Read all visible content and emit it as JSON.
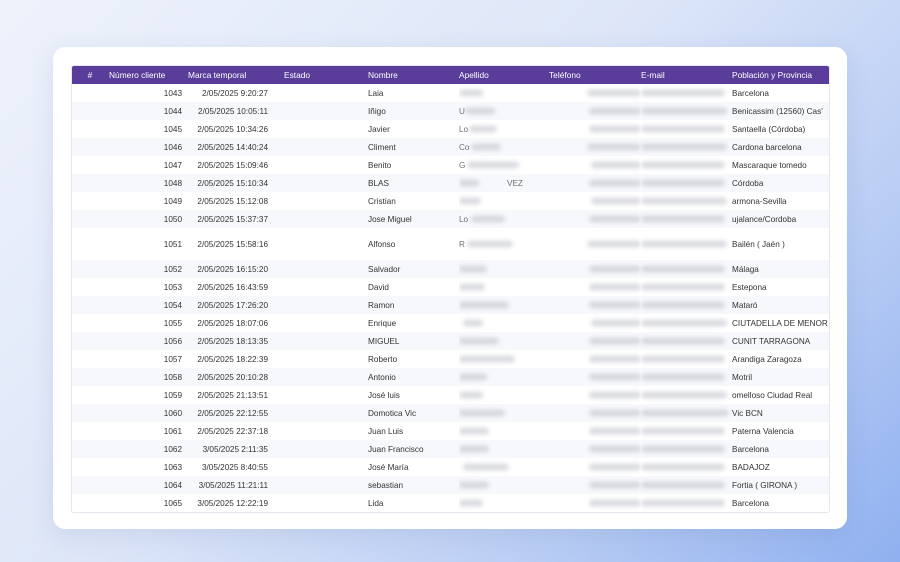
{
  "table": {
    "headers": {
      "num": "#",
      "cliente": "Número cliente",
      "marca": "Marca temporal",
      "estado": "Estado",
      "nombre": "Nombre",
      "apellido": "Apellido",
      "telefono": "Teléfono",
      "email": "E-mail",
      "poblacion": "Población y Provincia"
    },
    "rows": [
      {
        "cliente": "1043",
        "marca": "2/05/2025 9:20:27",
        "nombre": "Laia",
        "apellido": "",
        "poblacion": "Barcelona"
      },
      {
        "cliente": "1044",
        "marca": "2/05/2025 10:05:11",
        "nombre": "Iñigo",
        "apellido": "U",
        "poblacion": "Benicassim (12560) Cas'"
      },
      {
        "cliente": "1045",
        "marca": "2/05/2025 10:34:26",
        "nombre": "Javier",
        "apellido": "Lo",
        "poblacion": "Santaella (Córdoba)"
      },
      {
        "cliente": "1046",
        "marca": "2/05/2025 14:40:24",
        "nombre": "Climent",
        "apellido": "Co",
        "poblacion": "Cardona barcelona"
      },
      {
        "cliente": "1047",
        "marca": "2/05/2025 15:09:46",
        "nombre": "Benito",
        "apellido": "G",
        "poblacion": "Mascaraque tomedo"
      },
      {
        "cliente": "1048",
        "marca": "2/05/2025 15:10:34",
        "nombre": "BLAS",
        "apellido": "VEZ",
        "poblacion": "Córdoba"
      },
      {
        "cliente": "1049",
        "marca": "2/05/2025 15:12:08",
        "nombre": "Cristian",
        "apellido": "",
        "poblacion": "armona-Sevilla"
      },
      {
        "cliente": "1050",
        "marca": "2/05/2025 15:37:37",
        "nombre": "Jose Miguel",
        "apellido": "Lo",
        "poblacion": "ujalance/Cordoba"
      },
      {
        "cliente": "1051",
        "marca": "2/05/2025 15:58:16",
        "nombre": "Alfonso",
        "apellido": "R",
        "poblacion": "Bailén ( Jaén )"
      },
      {
        "cliente": "1052",
        "marca": "2/05/2025 16:15:20",
        "nombre": "Salvador",
        "apellido": "",
        "poblacion": "Málaga"
      },
      {
        "cliente": "1053",
        "marca": "2/05/2025 16:43:59",
        "nombre": "David",
        "apellido": "",
        "poblacion": "Estepona"
      },
      {
        "cliente": "1054",
        "marca": "2/05/2025 17:26:20",
        "nombre": "Ramon",
        "apellido": "",
        "poblacion": "Mataró"
      },
      {
        "cliente": "1055",
        "marca": "2/05/2025 18:07:06",
        "nombre": "Enrique",
        "apellido": "",
        "poblacion": "CIUTADELLA DE MENOR"
      },
      {
        "cliente": "1056",
        "marca": "2/05/2025 18:13:35",
        "nombre": "MIGUEL",
        "apellido": "",
        "poblacion": "CUNIT TARRAGONA"
      },
      {
        "cliente": "1057",
        "marca": "2/05/2025 18:22:39",
        "nombre": "Roberto",
        "apellido": "",
        "poblacion": "Arandiga Zaragoza"
      },
      {
        "cliente": "1058",
        "marca": "2/05/2025 20:10:28",
        "nombre": "Antonio",
        "apellido": "",
        "poblacion": "Motril"
      },
      {
        "cliente": "1059",
        "marca": "2/05/2025 21:13:51",
        "nombre": "José luis",
        "apellido": "",
        "poblacion": "omelloso Ciudad Real"
      },
      {
        "cliente": "1060",
        "marca": "2/05/2025 22:12:55",
        "nombre": "Domotica Vic",
        "apellido": "",
        "poblacion": "Vic BCN"
      },
      {
        "cliente": "1061",
        "marca": "2/05/2025 22:37:18",
        "nombre": "Juan Luis",
        "apellido": "",
        "poblacion": "Paterna Valencia"
      },
      {
        "cliente": "1062",
        "marca": "3/05/2025 2:11:35",
        "nombre": "Juan Francisco",
        "apellido": "",
        "poblacion": "Barcelona"
      },
      {
        "cliente": "1063",
        "marca": "3/05/2025 8:40:55",
        "nombre": "José María",
        "apellido": "",
        "poblacion": "BADAJOZ"
      },
      {
        "cliente": "1064",
        "marca": "3/05/2025 11:21:11",
        "nombre": "sebastian",
        "apellido": "",
        "poblacion": "Fortia ( GIRONA )"
      },
      {
        "cliente": "1065",
        "marca": "3/05/2025 12:22:19",
        "nombre": "Lida",
        "apellido": "",
        "poblacion": "Barcelona"
      }
    ]
  },
  "colors": {
    "header_bg": "#5a3d9a",
    "header_text": "#ffffff",
    "row_alt": "#f7f8fb"
  }
}
